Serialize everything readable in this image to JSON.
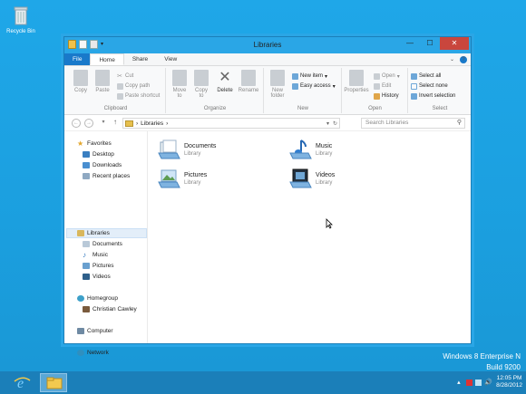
{
  "desktop": {
    "recycle_bin_label": "Recycle Bin",
    "watermark_line1": "Windows 8 Enterprise N",
    "watermark_line2": "Build 9200"
  },
  "window": {
    "title": "Libraries",
    "tabs": [
      "File",
      "Home",
      "Share",
      "View"
    ],
    "ribbon": {
      "clipboard": {
        "label": "Clipboard",
        "copy": "Copy",
        "paste": "Paste",
        "cut": "Cut",
        "copy_path": "Copy path",
        "paste_shortcut": "Paste shortcut"
      },
      "organize": {
        "label": "Organize",
        "move_to_line1": "Move",
        "move_to_line2": "to",
        "copy_to_line1": "Copy",
        "copy_to_line2": "to",
        "delete": "Delete",
        "rename": "Rename"
      },
      "new": {
        "label": "New",
        "new_folder_line1": "New",
        "new_folder_line2": "folder",
        "new_item": "New item",
        "easy_access": "Easy access"
      },
      "open": {
        "label": "Open",
        "properties": "Properties",
        "open": "Open",
        "edit": "Edit",
        "history": "History"
      },
      "select": {
        "label": "Select",
        "select_all": "Select all",
        "select_none": "Select none",
        "invert_selection": "Invert selection"
      }
    },
    "address": {
      "path_label": "Libraries",
      "search_placeholder": "Search Libraries"
    },
    "nav": {
      "favorites": "Favorites",
      "desktop": "Desktop",
      "downloads": "Downloads",
      "recent_places": "Recent places",
      "libraries": "Libraries",
      "documents": "Documents",
      "music": "Music",
      "pictures": "Pictures",
      "videos": "Videos",
      "homegroup": "Homegroup",
      "christian_cawley": "Christian Cawley",
      "computer": "Computer",
      "network": "Network"
    },
    "libraries": [
      {
        "name": "Documents",
        "type": "Library",
        "icon": "documents-library-icon"
      },
      {
        "name": "Music",
        "type": "Library",
        "icon": "music-library-icon"
      },
      {
        "name": "Pictures",
        "type": "Library",
        "icon": "pictures-library-icon"
      },
      {
        "name": "Videos",
        "type": "Library",
        "icon": "videos-library-icon"
      }
    ]
  },
  "taskbar": {
    "time": "12:05 PM",
    "date": "8/28/2012"
  },
  "colors": {
    "desktop_bg": "#1ba1e2",
    "title_bar": "#2aa6e6",
    "file_tab": "#1979ca",
    "close_button": "#c9463d",
    "taskbar": "#1b7fb9"
  }
}
